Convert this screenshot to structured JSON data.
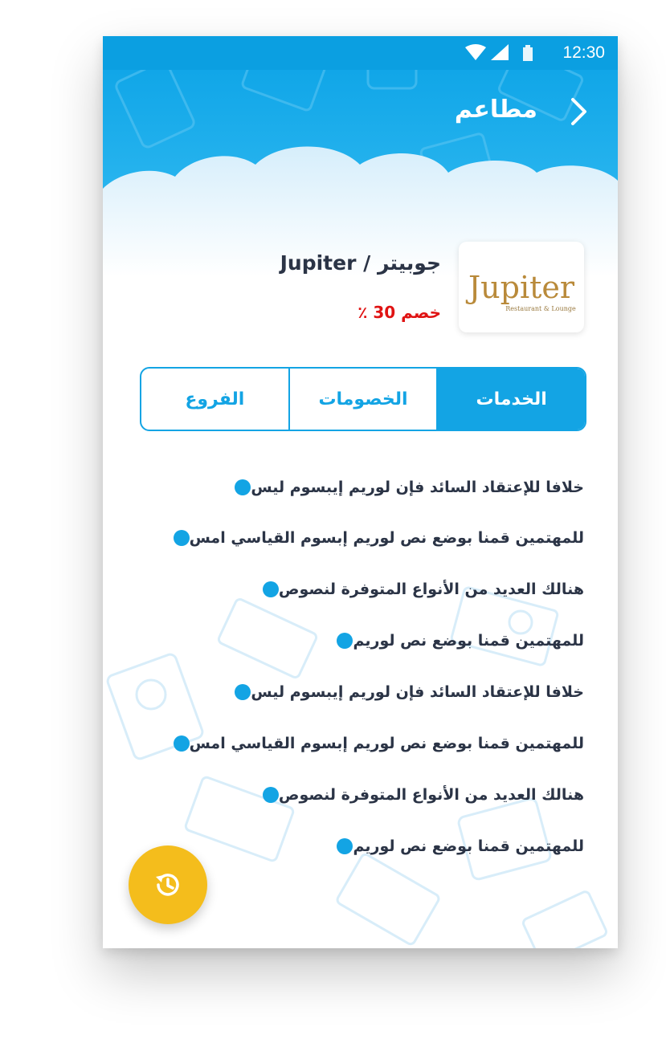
{
  "status_bar": {
    "time": "12:30"
  },
  "topbar": {
    "title": "مطاعم"
  },
  "restaurant": {
    "name": "جوبيتر / Jupiter",
    "discount": "خصم 30 ٪",
    "logo_text": "Jupiter",
    "logo_subtext": "Restaurant & Lounge"
  },
  "tabs": [
    {
      "label": "الخدمات",
      "active": true
    },
    {
      "label": "الخصومات",
      "active": false
    },
    {
      "label": "الفروع",
      "active": false
    }
  ],
  "services": [
    "خلافا للإعتقاد السائد فإن لوريم إيبسوم ليس",
    "للمهتمين قمنا بوضع نص لوريم إبسوم القياسي امس",
    "هنالك العديد من الأنواع المتوفرة لنصوص",
    "للمهتمين قمنا بوضع نص لوريم",
    "خلافا للإعتقاد السائد فإن لوريم إيبسوم ليس",
    "للمهتمين قمنا بوضع نص لوريم إبسوم القياسي امس",
    "هنالك العديد من الأنواع المتوفرة لنصوص",
    "للمهتمين قمنا بوضع نص لوريم"
  ],
  "fab": {
    "icon": "history-icon"
  },
  "colors": {
    "primary": "#13a4e4",
    "accent": "#f4bd1c",
    "discount": "#e01313",
    "text": "#2b3446"
  }
}
